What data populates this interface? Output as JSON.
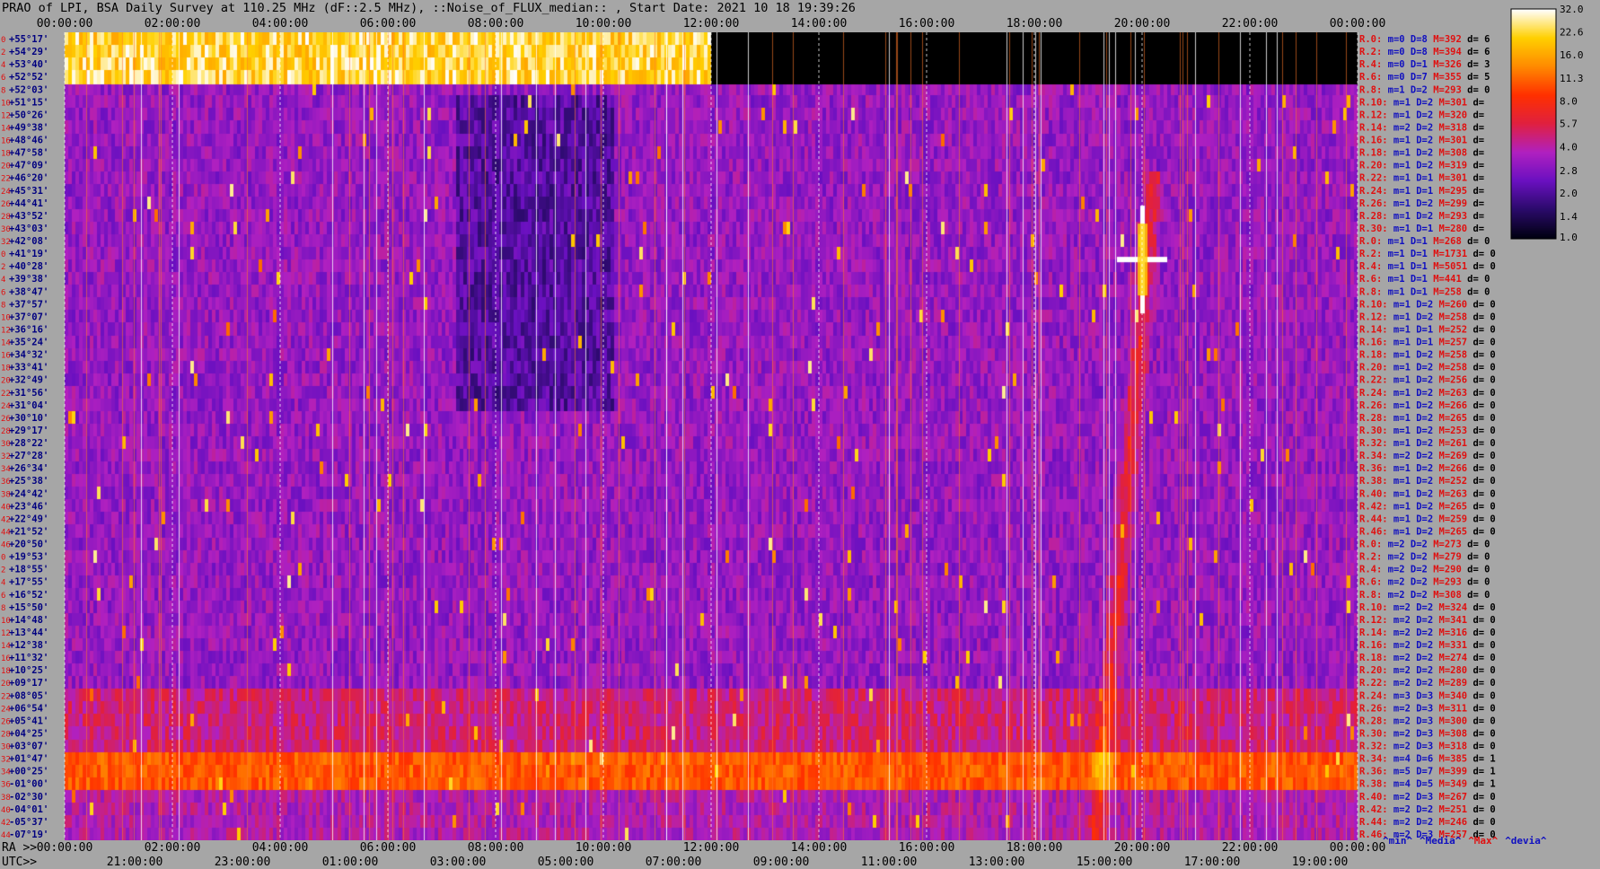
{
  "title": "PRAO of LPI, BSA Daily Survey at 110.25 MHz (dF::2.5 MHz), ::Noise_of_FLUX_median:: , Start Date: 2021 10 18 19:39:26",
  "chart_data": {
    "type": "heatmap",
    "title": "PRAO of LPI, BSA Daily Survey at 110.25 MHz (dF::2.5 MHz), ::Noise_of_FLUX_median:: , Start Date: 2021 10 18 19:39:26",
    "xlabel_ra": "RA >>",
    "xlabel_utc": "UTC>>",
    "top_ticks": [
      "00:00:00",
      "02:00:00",
      "04:00:00",
      "06:00:00",
      "08:00:00",
      "10:00:00",
      "12:00:00",
      "14:00:00",
      "16:00:00",
      "18:00:00",
      "20:00:00",
      "22:00:00",
      "00:00:00"
    ],
    "ra_ticks": [
      "00:00:00",
      "02:00:00",
      "04:00:00",
      "06:00:00",
      "08:00:00",
      "10:00:00",
      "12:00:00",
      "14:00:00",
      "16:00:00",
      "18:00:00",
      "20:00:00",
      "22:00:00",
      "00:00:00"
    ],
    "utc_ticks": [
      "21:00:00",
      "23:00:00",
      "01:00:00",
      "03:00:00",
      "05:00:00",
      "07:00:00",
      "09:00:00",
      "11:00:00",
      "13:00:00",
      "15:00:00",
      "17:00:00",
      "19:00:00"
    ],
    "row_indices": [
      "0",
      "2",
      "4",
      "6",
      "8",
      "10",
      "12",
      "14",
      "16",
      "18",
      "20",
      "22",
      "24",
      "26",
      "28",
      "30",
      "32",
      "0",
      "2",
      "4",
      "6",
      "8",
      "10",
      "12",
      "14",
      "16",
      "18",
      "20",
      "22",
      "24",
      "26",
      "28",
      "30",
      "32",
      "34",
      "36",
      "38",
      "40",
      "42",
      "44",
      "46",
      "0",
      "2",
      "4",
      "6",
      "8",
      "10",
      "12",
      "14",
      "16",
      "18",
      "20",
      "22",
      "24",
      "26",
      "28",
      "30",
      "32",
      "34",
      "36",
      "38",
      "40",
      "42",
      "44",
      "46"
    ],
    "declinations": [
      "+55°17'",
      "+54°29'",
      "+53°40'",
      "+52°52'",
      "+52°03'",
      "+51°15'",
      "+50°26'",
      "+49°38'",
      "+48°46'",
      "+47°58'",
      "+47°09'",
      "+46°20'",
      "+45°31'",
      "+44°41'",
      "+43°52'",
      "+43°03'",
      "+42°08'",
      "+41°19'",
      "+40°28'",
      "+39°38'",
      "+38°47'",
      "+37°57'",
      "+37°07'",
      "+36°16'",
      "+35°24'",
      "+34°32'",
      "+33°41'",
      "+32°49'",
      "+31°56'",
      "+31°04'",
      "+30°10'",
      "+29°17'",
      "+28°22'",
      "+27°28'",
      "+26°34'",
      "+25°38'",
      "+24°42'",
      "+23°46'",
      "+22°49'",
      "+21°52'",
      "+20°50'",
      "+19°53'",
      "+18°55'",
      "+17°55'",
      "+16°52'",
      "+15°50'",
      "+14°48'",
      "+13°44'",
      "+12°38'",
      "+11°32'",
      "+10°25'",
      "+09°17'",
      "+08°05'",
      "+06°54'",
      "+05°41'",
      "+04°25'",
      "+03°07'",
      "+01°47'",
      "+00°25'",
      "-01°00'",
      "-02°30'",
      "-04°01'",
      "-05°37'",
      "-07°19'"
    ],
    "row_stats": [
      {
        "r": "R.0:",
        "m": "m=0",
        "d": "D=8",
        "M": "M=392",
        "dev": "d= 6"
      },
      {
        "r": "R.2:",
        "m": "m=0",
        "d": "D=8",
        "M": "M=394",
        "dev": "d= 6"
      },
      {
        "r": "R.4:",
        "m": "m=0",
        "d": "D=1",
        "M": "M=326",
        "dev": "d= 3"
      },
      {
        "r": "R.6:",
        "m": "m=0",
        "d": "D=7",
        "M": "M=355",
        "dev": "d= 5"
      },
      {
        "r": "R.8:",
        "m": "m=1",
        "d": "D=2",
        "M": "M=293",
        "dev": "d= 0"
      },
      {
        "r": "R.10:",
        "m": "m=1",
        "d": "D=2",
        "M": "M=301",
        "dev": "d="
      },
      {
        "r": "R.12:",
        "m": "m=1",
        "d": "D=2",
        "M": "M=320",
        "dev": "d="
      },
      {
        "r": "R.14:",
        "m": "m=2",
        "d": "D=2",
        "M": "M=318",
        "dev": "d="
      },
      {
        "r": "R.16:",
        "m": "m=1",
        "d": "D=2",
        "M": "M=301",
        "dev": "d="
      },
      {
        "r": "R.18:",
        "m": "m=1",
        "d": "D=2",
        "M": "M=308",
        "dev": "d="
      },
      {
        "r": "R.20:",
        "m": "m=1",
        "d": "D=2",
        "M": "M=319",
        "dev": "d="
      },
      {
        "r": "R.22:",
        "m": "m=1",
        "d": "D=1",
        "M": "M=301",
        "dev": "d="
      },
      {
        "r": "R.24:",
        "m": "m=1",
        "d": "D=1",
        "M": "M=295",
        "dev": "d="
      },
      {
        "r": "R.26:",
        "m": "m=1",
        "d": "D=2",
        "M": "M=299",
        "dev": "d="
      },
      {
        "r": "R.28:",
        "m": "m=1",
        "d": "D=2",
        "M": "M=293",
        "dev": "d="
      },
      {
        "r": "R.30:",
        "m": "m=1",
        "d": "D=1",
        "M": "M=280",
        "dev": "d="
      },
      {
        "r": "R.0:",
        "m": "m=1",
        "d": "D=1",
        "M": "M=268",
        "dev": "d= 0"
      },
      {
        "r": "R.2:",
        "m": "m=1",
        "d": "D=1",
        "M": "M=1731",
        "dev": "d= 0"
      },
      {
        "r": "R.4:",
        "m": "m=1",
        "d": "D=1",
        "M": "M=5051",
        "dev": "d= 0"
      },
      {
        "r": "R.6:",
        "m": "m=1",
        "d": "D=1",
        "M": "M=441",
        "dev": "d= 0"
      },
      {
        "r": "R.8:",
        "m": "m=1",
        "d": "D=1",
        "M": "M=258",
        "dev": "d= 0"
      },
      {
        "r": "R.10:",
        "m": "m=1",
        "d": "D=2",
        "M": "M=260",
        "dev": "d= 0"
      },
      {
        "r": "R.12:",
        "m": "m=1",
        "d": "D=2",
        "M": "M=258",
        "dev": "d= 0"
      },
      {
        "r": "R.14:",
        "m": "m=1",
        "d": "D=1",
        "M": "M=252",
        "dev": "d= 0"
      },
      {
        "r": "R.16:",
        "m": "m=1",
        "d": "D=1",
        "M": "M=257",
        "dev": "d= 0"
      },
      {
        "r": "R.18:",
        "m": "m=1",
        "d": "D=2",
        "M": "M=258",
        "dev": "d= 0"
      },
      {
        "r": "R.20:",
        "m": "m=1",
        "d": "D=2",
        "M": "M=258",
        "dev": "d= 0"
      },
      {
        "r": "R.22:",
        "m": "m=1",
        "d": "D=2",
        "M": "M=256",
        "dev": "d= 0"
      },
      {
        "r": "R.24:",
        "m": "m=1",
        "d": "D=2",
        "M": "M=263",
        "dev": "d= 0"
      },
      {
        "r": "R.26:",
        "m": "m=1",
        "d": "D=2",
        "M": "M=266",
        "dev": "d= 0"
      },
      {
        "r": "R.28:",
        "m": "m=1",
        "d": "D=2",
        "M": "M=265",
        "dev": "d= 0"
      },
      {
        "r": "R.30:",
        "m": "m=1",
        "d": "D=2",
        "M": "M=253",
        "dev": "d= 0"
      },
      {
        "r": "R.32:",
        "m": "m=1",
        "d": "D=2",
        "M": "M=261",
        "dev": "d= 0"
      },
      {
        "r": "R.34:",
        "m": "m=2",
        "d": "D=2",
        "M": "M=269",
        "dev": "d= 0"
      },
      {
        "r": "R.36:",
        "m": "m=1",
        "d": "D=2",
        "M": "M=266",
        "dev": "d= 0"
      },
      {
        "r": "R.38:",
        "m": "m=1",
        "d": "D=2",
        "M": "M=252",
        "dev": "d= 0"
      },
      {
        "r": "R.40:",
        "m": "m=1",
        "d": "D=2",
        "M": "M=263",
        "dev": "d= 0"
      },
      {
        "r": "R.42:",
        "m": "m=1",
        "d": "D=2",
        "M": "M=265",
        "dev": "d= 0"
      },
      {
        "r": "R.44:",
        "m": "m=1",
        "d": "D=2",
        "M": "M=259",
        "dev": "d= 0"
      },
      {
        "r": "R.46:",
        "m": "m=1",
        "d": "D=2",
        "M": "M=265",
        "dev": "d= 0"
      },
      {
        "r": "R.0:",
        "m": "m=2",
        "d": "D=2",
        "M": "M=273",
        "dev": "d= 0"
      },
      {
        "r": "R.2:",
        "m": "m=2",
        "d": "D=2",
        "M": "M=279",
        "dev": "d= 0"
      },
      {
        "r": "R.4:",
        "m": "m=2",
        "d": "D=2",
        "M": "M=290",
        "dev": "d= 0"
      },
      {
        "r": "R.6:",
        "m": "m=2",
        "d": "D=2",
        "M": "M=293",
        "dev": "d= 0"
      },
      {
        "r": "R.8:",
        "m": "m=2",
        "d": "D=2",
        "M": "M=308",
        "dev": "d= 0"
      },
      {
        "r": "R.10:",
        "m": "m=2",
        "d": "D=2",
        "M": "M=324",
        "dev": "d= 0"
      },
      {
        "r": "R.12:",
        "m": "m=2",
        "d": "D=2",
        "M": "M=341",
        "dev": "d= 0"
      },
      {
        "r": "R.14:",
        "m": "m=2",
        "d": "D=2",
        "M": "M=316",
        "dev": "d= 0"
      },
      {
        "r": "R.16:",
        "m": "m=2",
        "d": "D=2",
        "M": "M=331",
        "dev": "d= 0"
      },
      {
        "r": "R.18:",
        "m": "m=2",
        "d": "D=2",
        "M": "M=274",
        "dev": "d= 0"
      },
      {
        "r": "R.20:",
        "m": "m=2",
        "d": "D=2",
        "M": "M=280",
        "dev": "d= 0"
      },
      {
        "r": "R.22:",
        "m": "m=2",
        "d": "D=2",
        "M": "M=289",
        "dev": "d= 0"
      },
      {
        "r": "R.24:",
        "m": "m=3",
        "d": "D=3",
        "M": "M=340",
        "dev": "d= 0"
      },
      {
        "r": "R.26:",
        "m": "m=2",
        "d": "D=3",
        "M": "M=311",
        "dev": "d= 0"
      },
      {
        "r": "R.28:",
        "m": "m=2",
        "d": "D=3",
        "M": "M=300",
        "dev": "d= 0"
      },
      {
        "r": "R.30:",
        "m": "m=2",
        "d": "D=3",
        "M": "M=308",
        "dev": "d= 0"
      },
      {
        "r": "R.32:",
        "m": "m=2",
        "d": "D=3",
        "M": "M=318",
        "dev": "d= 0"
      },
      {
        "r": "R.34:",
        "m": "m=4",
        "d": "D=6",
        "M": "M=385",
        "dev": "d= 1"
      },
      {
        "r": "R.36:",
        "m": "m=5",
        "d": "D=7",
        "M": "M=399",
        "dev": "d= 1"
      },
      {
        "r": "R.38:",
        "m": "m=4",
        "d": "D=5",
        "M": "M=349",
        "dev": "d= 1"
      },
      {
        "r": "R.40:",
        "m": "m=2",
        "d": "D=3",
        "M": "M=267",
        "dev": "d= 0"
      },
      {
        "r": "R.42:",
        "m": "m=2",
        "d": "D=2",
        "M": "M=251",
        "dev": "d= 0"
      },
      {
        "r": "R.44:",
        "m": "m=2",
        "d": "D=2",
        "M": "M=246",
        "dev": "d= 0"
      },
      {
        "r": "R.46:",
        "m": "m=2",
        "d": "D=3",
        "M": "M=257",
        "dev": "d= 0"
      }
    ],
    "colorbar_ticks": [
      "32.0",
      "22.6",
      "16.0",
      "11.3",
      "8.0",
      "5.7",
      "4.0",
      "2.8",
      "2.0",
      "1.4",
      "1.0"
    ],
    "colorbar_range": [
      1.0,
      32.0
    ],
    "colorbar_scale": "log",
    "legend_footer": [
      {
        "text": "^min^",
        "color": "#1010c0"
      },
      {
        "text": "^Media^",
        "color": "#1010c0"
      },
      {
        "text": "^Max^",
        "color": "#e01010"
      },
      {
        "text": "^devia^",
        "color": "#1010c0"
      }
    ],
    "colormap": [
      "#000010",
      "#2a0a6a",
      "#6a10c0",
      "#b020c0",
      "#e02040",
      "#ff3000",
      "#ff8a00",
      "#ffd000",
      "#ffffff"
    ],
    "features": {
      "saturated_top_band": "rows +55°17' to +52°52', 00:00 to 12:00",
      "bright_horizontal_band": "rows +01°47' to -01°00'",
      "bright_source": "near 20:00 RA, +41°19' to +40°28'"
    }
  }
}
